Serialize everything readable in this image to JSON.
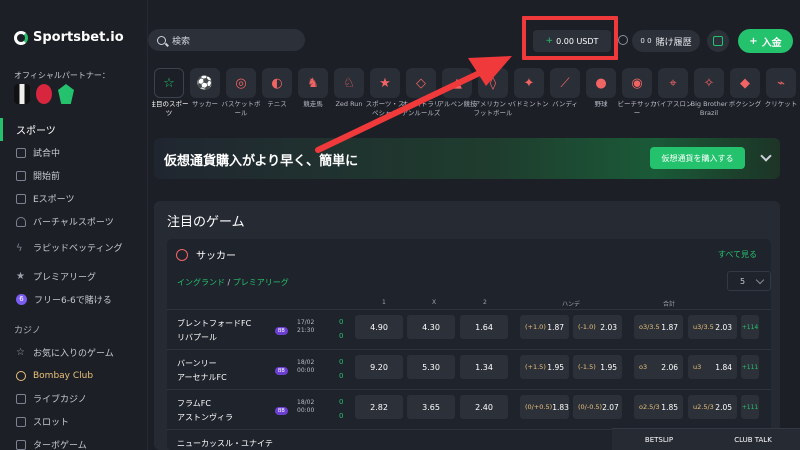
{
  "brand": {
    "name": "Sportsbet.io"
  },
  "sidebar": {
    "partner_label": "オフィシャルパートナー：",
    "items": [
      {
        "label": "スポーツ"
      },
      {
        "label": "試合中"
      },
      {
        "label": "開始前"
      },
      {
        "label": "Eスポーツ"
      },
      {
        "label": "バーチャルスポーツ"
      },
      {
        "label": "ラピッドベッティング"
      },
      {
        "label": "プレミアリーグ"
      },
      {
        "label": "フリー6-6で賭ける",
        "badge": "6"
      }
    ],
    "casino_title": "カジノ",
    "casino_items": [
      {
        "label": "お気に入りのゲーム"
      },
      {
        "label": "Bombay Club"
      },
      {
        "label": "ライブカジノ"
      },
      {
        "label": "スロット"
      },
      {
        "label": "ターボゲーム"
      }
    ]
  },
  "topbar": {
    "search_placeholder": "検索",
    "balance_plus": "+",
    "balance": "0.00 USDT",
    "history_label": "賭け履歴",
    "history_glyph": "0 0",
    "deposit_plus": "+",
    "deposit_label": "入金"
  },
  "sports": [
    {
      "label": "注目のスポーツ",
      "icon": "☆"
    },
    {
      "label": "サッカー",
      "icon": "⚽"
    },
    {
      "label": "バスケットボール",
      "icon": "◎"
    },
    {
      "label": "テニス",
      "icon": "◐"
    },
    {
      "label": "競走馬",
      "icon": "♞"
    },
    {
      "label": "Zed Run",
      "icon": "♘"
    },
    {
      "label": "スポーツ・スペシャル",
      "icon": "★"
    },
    {
      "label": "オーストラリアンルールズ",
      "icon": "◇"
    },
    {
      "label": "アルペン競技",
      "icon": "▲"
    },
    {
      "label": "アメリカン・フットボール",
      "icon": "◊"
    },
    {
      "label": "バドミントン",
      "icon": "✦"
    },
    {
      "label": "バンディ",
      "icon": "⟋"
    },
    {
      "label": "野球",
      "icon": "●"
    },
    {
      "label": "ビーチサッカー",
      "icon": "◉"
    },
    {
      "label": "バイアスロン",
      "icon": "⌖"
    },
    {
      "label": "Big Brother Brazil",
      "icon": "✧"
    },
    {
      "label": "ボクシング",
      "icon": "◆"
    },
    {
      "label": "クリケット",
      "icon": "⌁"
    }
  ],
  "promo": {
    "text": "仮想通貨購入がより早く、簡単に",
    "button": "仮想通貨を購入する"
  },
  "featured": {
    "title": "注目のゲーム",
    "sport": "サッカー",
    "see_all": "すべて見る",
    "league_country": "イングランド",
    "league_sep": "/",
    "league_name": "プレミアリーグ",
    "league_count": "5",
    "columns": {
      "one": "1",
      "x": "X",
      "two": "2",
      "handicap": "ハンデ",
      "total": "合計"
    },
    "matches": [
      {
        "home": "ブレントフォードFC",
        "away": "リバプール",
        "tag": "BB",
        "date": "17/02",
        "time": "21:30",
        "s1": "0",
        "s2": "0",
        "o1": "4.90",
        "ox": "4.30",
        "o2": "1.64",
        "h1l": "(+1.0)",
        "h1": "1.87",
        "h2l": "(-1.0)",
        "h2": "2.03",
        "t1l": "o3/3.5",
        "t1": "1.87",
        "t2l": "u3/3.5",
        "t2": "2.03",
        "more": "+114"
      },
      {
        "home": "バーンリー",
        "away": "アーセナルFC",
        "tag": "BB",
        "date": "18/02",
        "time": "00:00",
        "s1": "0",
        "s2": "0",
        "o1": "9.20",
        "ox": "5.30",
        "o2": "1.34",
        "h1l": "(+1.5)",
        "h1": "1.95",
        "h2l": "(-1.5)",
        "h2": "1.95",
        "t1l": "o3",
        "t1": "2.06",
        "t2l": "u3",
        "t2": "1.84",
        "more": "+111"
      },
      {
        "home": "フラムFC",
        "away": "アストンヴィラ",
        "tag": "BB",
        "date": "18/02",
        "time": "00:00",
        "s1": "0",
        "s2": "0",
        "o1": "2.82",
        "ox": "3.65",
        "o2": "2.40",
        "h1l": "(0/+0.5)",
        "h1": "1.83",
        "h2l": "(0/-0.5)",
        "h2": "2.07",
        "t1l": "o2.5/3",
        "t1": "1.85",
        "t2l": "u2.5/3",
        "t2": "2.05",
        "more": "+111"
      },
      {
        "home": "ニューカッスル・ユナイテ"
      }
    ]
  },
  "betslip": {
    "betslip": "BETSLIP",
    "club_talk": "CLUB TALK"
  },
  "colors": {
    "accent": "#25c26e",
    "annotation": "#f0393a",
    "background": "#1c1f26"
  },
  "icons": [
    "search-icon",
    "gift-icon",
    "wallet-icon",
    "star-icon",
    "chevron-down-icon",
    "annotation-arrow"
  ]
}
